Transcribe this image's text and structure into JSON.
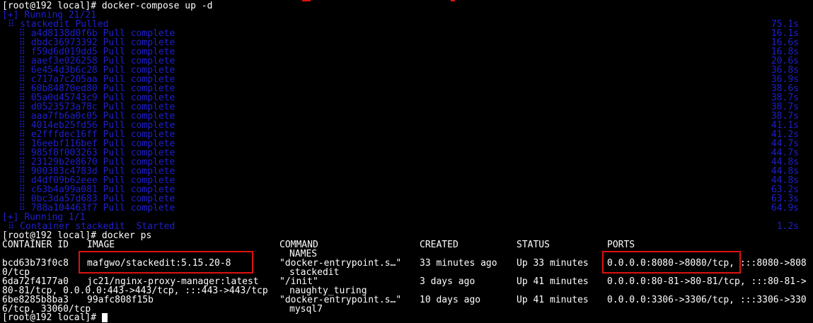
{
  "terminal": {
    "prompt": "[root@192 local]#",
    "command_compose": " docker-compose up -d",
    "running_header": "[+] Running 21/21",
    "pulled_line": " ⠿ stackedit Pulled",
    "pulled_time": "75.1s",
    "layers": [
      {
        "text": "   ⠿ a4d8138d0f6b Pull complete",
        "time": "16.1s"
      },
      {
        "text": "   ⠿ dbdc36973392 Pull complete",
        "time": "16.6s"
      },
      {
        "text": "   ⠿ f59d6d019dd5 Pull complete",
        "time": "16.8s"
      },
      {
        "text": "   ⠿ aaef3e026258 Pull complete",
        "time": "20.6s"
      },
      {
        "text": "   ⠿ 6e454d3b6c28 Pull complete",
        "time": "36.8s"
      },
      {
        "text": "   ⠿ c717a7c205aa Pull complete",
        "time": "36.9s"
      },
      {
        "text": "   ⠿ 60b84870ed80 Pull complete",
        "time": "38.6s"
      },
      {
        "text": "   ⠿ 05a0d45743c9 Pull complete",
        "time": "38.7s"
      },
      {
        "text": "   ⠿ d0523573a78c Pull complete",
        "time": "38.7s"
      },
      {
        "text": "   ⠿ aaa7fb6a0c05 Pull complete",
        "time": "38.7s"
      },
      {
        "text": "   ⠿ 4014eb25fd56 Pull complete",
        "time": "41.1s"
      },
      {
        "text": "   ⠿ e2fffdec16ff Pull complete",
        "time": "41.2s"
      },
      {
        "text": "   ⠿ 16eebf116bef Pull complete",
        "time": "44.7s"
      },
      {
        "text": "   ⠿ 985f8f003263 Pull complete",
        "time": "44.7s"
      },
      {
        "text": "   ⠿ 23129b2e8670 Pull complete",
        "time": "44.8s"
      },
      {
        "text": "   ⠿ 900383c4783d Pull complete",
        "time": "44.8s"
      },
      {
        "text": "   ⠿ d4df09b62eee Pull complete",
        "time": "44.8s"
      },
      {
        "text": "   ⠿ c63b4a99a081 Pull complete",
        "time": "63.2s"
      },
      {
        "text": "   ⠿ 0bc3da57d683 Pull complete",
        "time": "63.3s"
      },
      {
        "text": "   ⠿ 788a104463f7 Pull complete",
        "time": "64.9s"
      }
    ],
    "running_header_2": "[+] Running 1/1",
    "container_started": " ⠿ Container stackedit  Started",
    "container_started_time": "1.2s",
    "command_ps": " docker ps",
    "ps_headers": {
      "container_id": "CONTAINER ID",
      "image": "IMAGE",
      "command": "COMMAND",
      "created": "CREATED",
      "status": "STATUS",
      "ports": "PORTS",
      "names": "NAMES"
    },
    "rows": [
      {
        "container_id": "bcd63b73f0c8",
        "image": "mafgwo/stackedit:5.15.20-8",
        "command": "\"docker-entrypoint.s…\"",
        "created": "33 minutes ago",
        "status": "Up 33 minutes",
        "ports": "0.0.0.0:8080->8080/tcp,",
        "ports_rest": " :::8080->808",
        "wrap": "0/tcp",
        "names": "stackedit"
      },
      {
        "container_id": "6da72f4177a0",
        "image": "jc21/nginx-proxy-manager:latest",
        "command": "\"/init\"",
        "created": "3 days ago",
        "status": "Up 41 minutes",
        "ports": "0.0.0.0:80-81->80-81/tcp, :::80-81->",
        "wrap": "80-81/tcp, 0.0.0.0:443->443/tcp, :::443->443/tcp",
        "names": "naughty_turing"
      },
      {
        "container_id": "6be8285b8ba3",
        "image": "99afc808f15b",
        "command": "\"docker-entrypoint.s…\"",
        "created": "10 days ago",
        "status": "Up 41 minutes",
        "ports": "0.0.0.0:3306->3306/tcp, :::3306->330",
        "wrap": "6/tcp, 33060/tcp",
        "names": "mysql7"
      }
    ]
  },
  "colors": {
    "background": "#000000",
    "text": "#ffffff",
    "progress_blue": "#1f1fcf",
    "highlight_red": "#e01010"
  }
}
